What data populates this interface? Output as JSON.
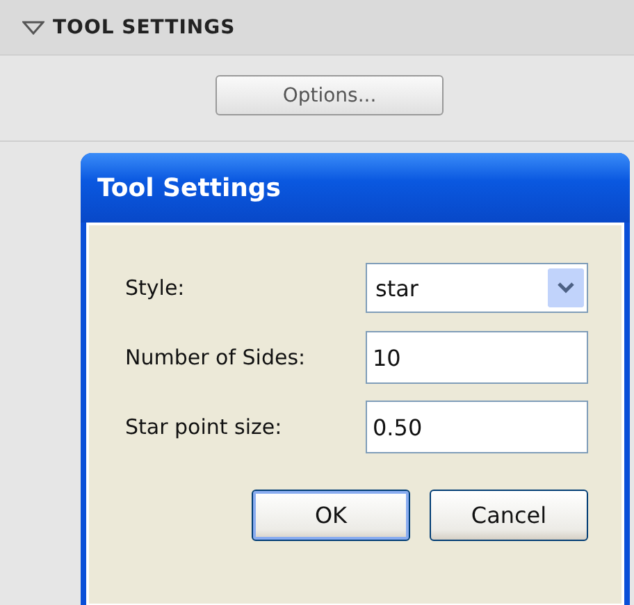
{
  "panel": {
    "title": "TOOL SETTINGS",
    "expanded": true,
    "button": "Options..."
  },
  "dialog": {
    "title": "Tool Settings",
    "fields": [
      {
        "kind": "select",
        "label": "Style:",
        "value": "star"
      },
      {
        "kind": "text",
        "label": "Number of Sides:",
        "value": "10"
      },
      {
        "kind": "text",
        "label": "Star point size:",
        "value": "0.50"
      }
    ],
    "buttons": [
      {
        "label": "OK",
        "default": true
      },
      {
        "label": "Cancel",
        "default": false
      }
    ]
  }
}
